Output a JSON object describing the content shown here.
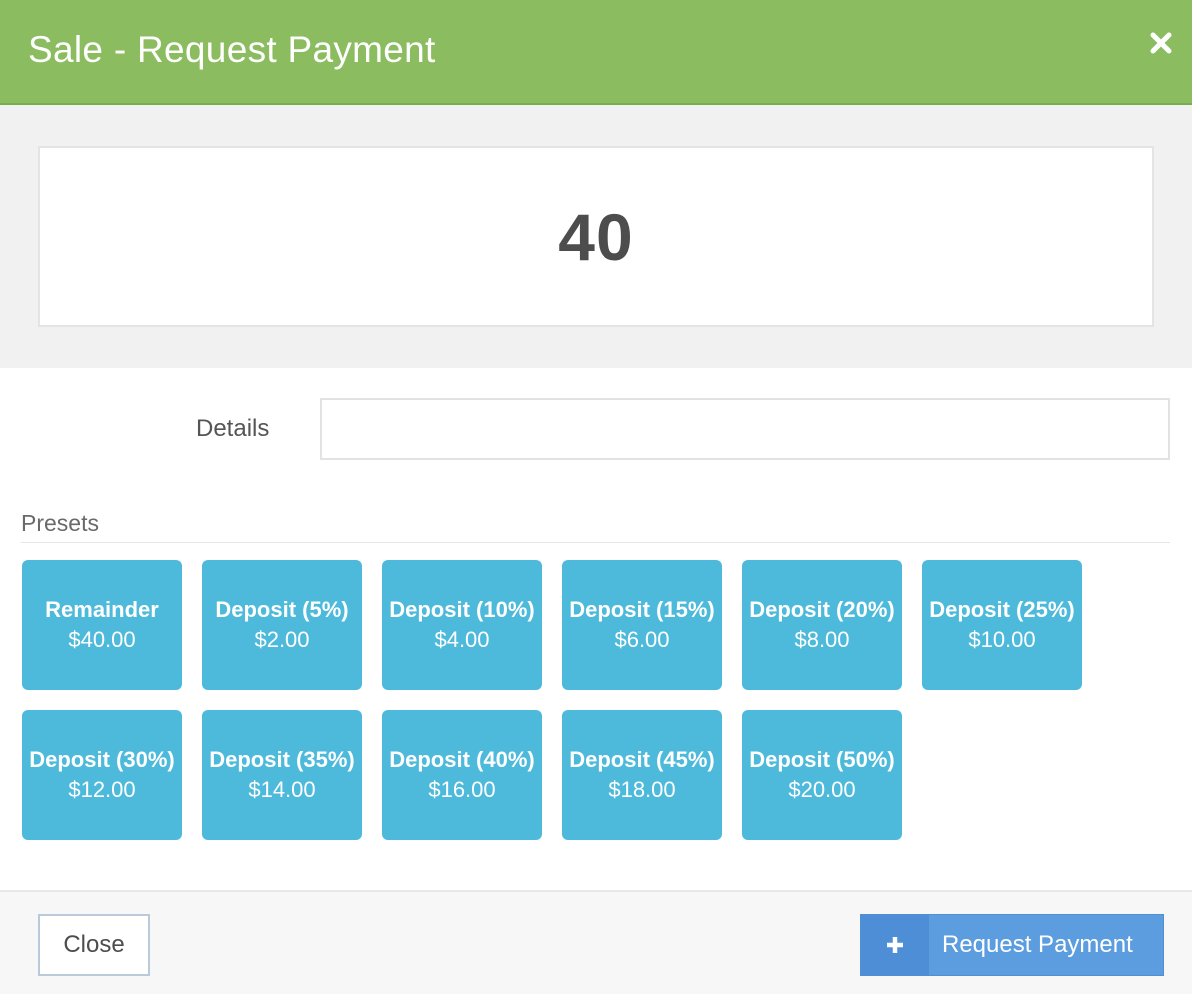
{
  "header": {
    "title": "Sale - Request Payment",
    "close_icon": "close-x-icon"
  },
  "amount": {
    "value": "40"
  },
  "details": {
    "label": "Details",
    "value": "",
    "placeholder": ""
  },
  "presets": {
    "label": "Presets",
    "items": [
      {
        "name": "Remainder",
        "amount": "$40.00"
      },
      {
        "name": "Deposit (5%)",
        "amount": "$2.00"
      },
      {
        "name": "Deposit (10%)",
        "amount": "$4.00"
      },
      {
        "name": "Deposit (15%)",
        "amount": "$6.00"
      },
      {
        "name": "Deposit (20%)",
        "amount": "$8.00"
      },
      {
        "name": "Deposit (25%)",
        "amount": "$10.00"
      },
      {
        "name": "Deposit (30%)",
        "amount": "$12.00"
      },
      {
        "name": "Deposit (35%)",
        "amount": "$14.00"
      },
      {
        "name": "Deposit (40%)",
        "amount": "$16.00"
      },
      {
        "name": "Deposit (45%)",
        "amount": "$18.00"
      },
      {
        "name": "Deposit (50%)",
        "amount": "$20.00"
      }
    ]
  },
  "footer": {
    "close_label": "Close",
    "request_label": "Request Payment",
    "request_icon": "plus-icon"
  },
  "colors": {
    "header": "#8bbd60",
    "preset_tile": "#4dbadb",
    "primary_button": "#5c9de0",
    "primary_button_icon_area": "#4e8ed6"
  }
}
